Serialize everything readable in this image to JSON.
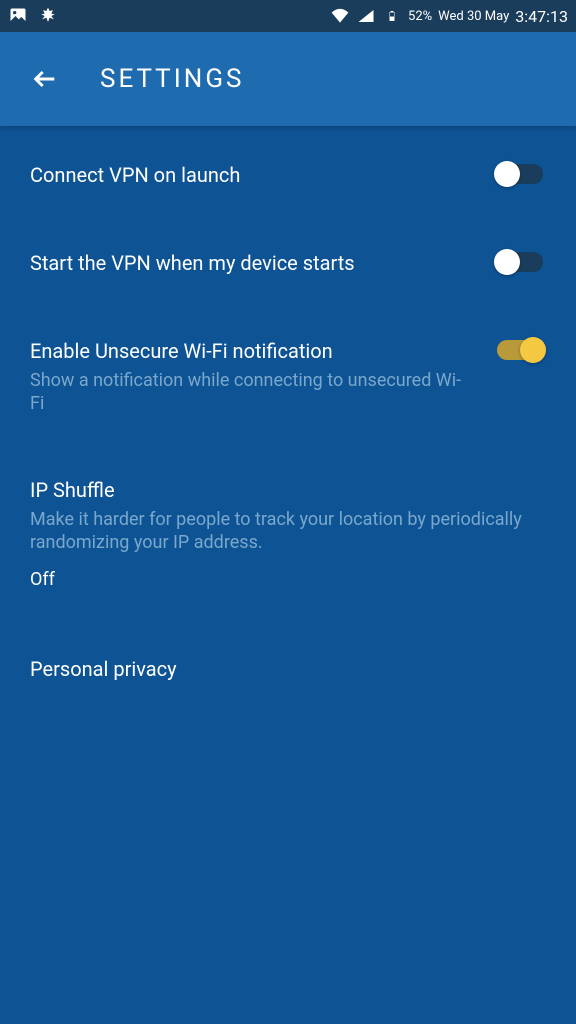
{
  "statusBar": {
    "battery": "52%",
    "date": "Wed 30 May",
    "time": "3:47:13"
  },
  "header": {
    "title": "SETTINGS"
  },
  "settings": {
    "connectOnLaunch": {
      "title": "Connect VPN on launch"
    },
    "startOnBoot": {
      "title": "Start the VPN when my device starts"
    },
    "wifiNotification": {
      "title": "Enable Unsecure Wi-Fi notification",
      "subtitle": "Show a notification while connecting to unsecured Wi-Fi"
    },
    "ipShuffle": {
      "title": "IP Shuffle",
      "subtitle": "Make it harder for people to track your location by periodically randomizing your IP address.",
      "status": "Off"
    },
    "personalPrivacy": {
      "title": "Personal privacy"
    }
  }
}
